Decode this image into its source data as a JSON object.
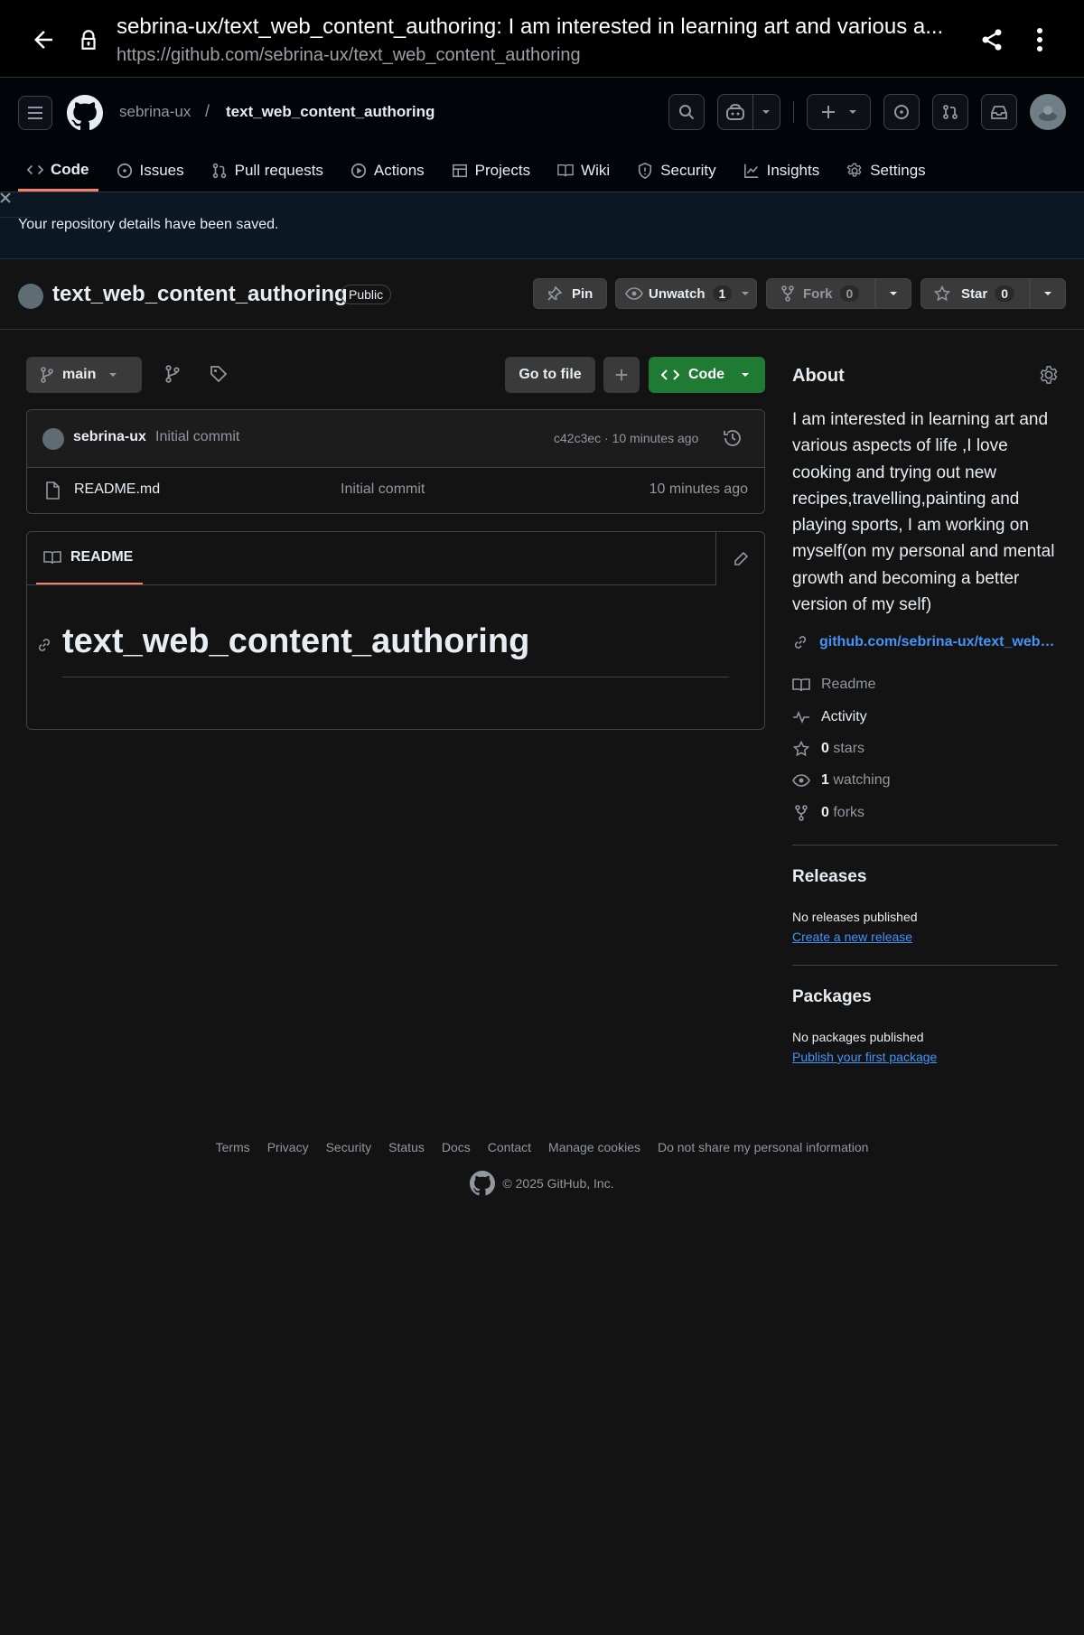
{
  "browser": {
    "title": "sebrina-ux/text_web_content_authoring: I am interested in learning art and various a...",
    "url": "https://github.com/sebrina-ux/text_web_content_authoring"
  },
  "header": {
    "owner": "sebrina-ux",
    "separator": "/",
    "repo": "text_web_content_authoring"
  },
  "tabs": [
    {
      "label": "Code",
      "icon": "code-icon"
    },
    {
      "label": "Issues",
      "icon": "issue-icon"
    },
    {
      "label": "Pull requests",
      "icon": "pull-request-icon"
    },
    {
      "label": "Actions",
      "icon": "play-icon"
    },
    {
      "label": "Projects",
      "icon": "table-icon"
    },
    {
      "label": "Wiki",
      "icon": "book-icon"
    },
    {
      "label": "Security",
      "icon": "shield-icon"
    },
    {
      "label": "Insights",
      "icon": "graph-icon"
    },
    {
      "label": "Settings",
      "icon": "gear-icon"
    }
  ],
  "flash": {
    "message": "Your repository details have been saved."
  },
  "repo": {
    "name": "text_web_content_authoring",
    "visibility": "Public",
    "pin_label": "Pin",
    "unwatch_label": "Unwatch",
    "watch_count": "1",
    "fork_label": "Fork",
    "fork_count": "0",
    "star_label": "Star",
    "star_count": "0"
  },
  "toolbar": {
    "branch": "main",
    "go_to_file": "Go to file",
    "code_label": "Code"
  },
  "commit": {
    "user": "sebrina-ux",
    "message": "Initial commit",
    "hash_time": "c42c3ec · 10 minutes ago"
  },
  "files": [
    {
      "name": "README.md",
      "message": "Initial commit",
      "time": "10 minutes ago"
    }
  ],
  "readme": {
    "tab_label": "README",
    "heading": "text_web_content_authoring"
  },
  "about": {
    "heading": "About",
    "description": "I am interested in learning art and various aspects of life ,I love cooking and trying out new recipes,travelling,painting and playing sports, I am working on myself(on my personal and mental growth and becoming a better version of my self)",
    "link": "github.com/sebrina-ux/text_web_content_authoring",
    "readme": "Readme",
    "activity": "Activity",
    "stars_count": "0",
    "stars_label": "stars",
    "watching_count": "1",
    "watching_label": "watching",
    "forks_count": "0",
    "forks_label": "forks"
  },
  "releases": {
    "heading": "Releases",
    "text": "No releases published",
    "link": "Create a new release"
  },
  "packages": {
    "heading": "Packages",
    "text": "No packages published",
    "link": "Publish your first package"
  },
  "footer": {
    "links": [
      "Terms",
      "Privacy",
      "Security",
      "Status",
      "Docs",
      "Contact",
      "Manage cookies",
      "Do not share my personal information"
    ],
    "copyright": "© 2025 GitHub, Inc."
  },
  "colors": {
    "accent_tab": "#f78166",
    "code_button": "#1f7a33",
    "link": "#4493f8",
    "background": "#131313"
  }
}
